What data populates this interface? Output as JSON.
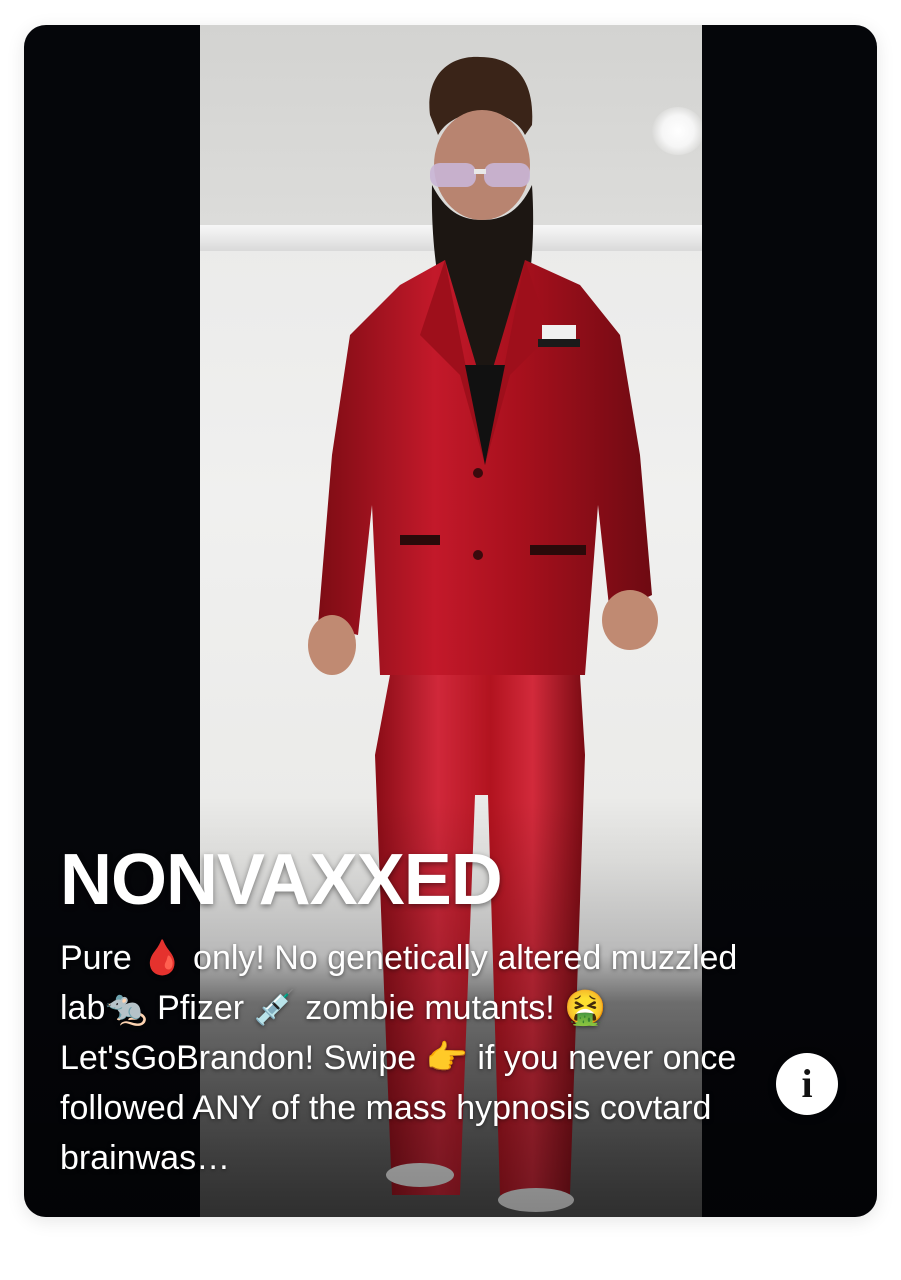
{
  "profile": {
    "name": "NONVAXXED",
    "bio": "Pure 🩸 only! No genetically altered muzzled lab🐀 Pfizer 💉 zombie mutants! 🤮Let'sGoBrandon! Swipe 👉 if you never once followed ANY of the mass hypnosis covtard brainwas…"
  },
  "info_button": {
    "label": "i",
    "icon": "info-icon"
  },
  "colors": {
    "card_background": "#05060a",
    "suit": "#b3121e",
    "text": "#ffffff"
  }
}
